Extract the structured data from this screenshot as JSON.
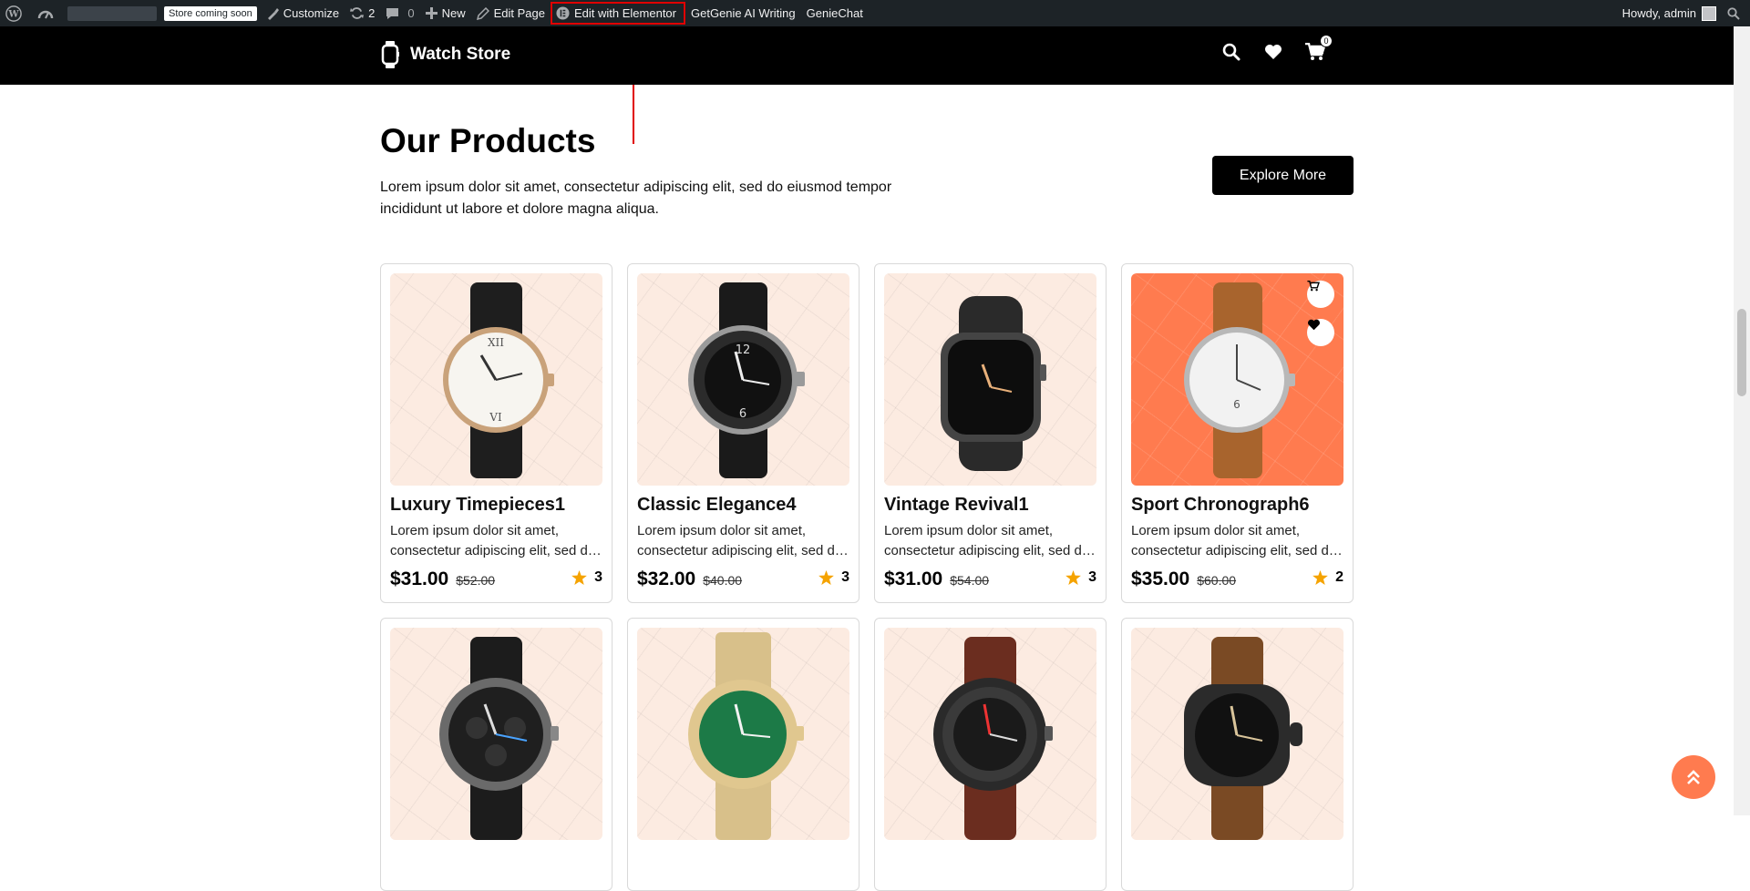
{
  "adminbar": {
    "store_badge": "Store coming soon",
    "customize": "Customize",
    "updates_count": "2",
    "comments_count": "0",
    "new": "New",
    "edit_page": "Edit Page",
    "edit_elementor": "Edit with Elementor",
    "getgenie": "GetGenie AI Writing",
    "geniechat": "GenieChat",
    "howdy": "Howdy, admin"
  },
  "header": {
    "logo_text": "Watch Store",
    "cart_count": "0"
  },
  "section": {
    "title": "Our Products",
    "description": "Lorem ipsum dolor sit amet, consectetur adipiscing elit, sed do eiusmod tempor incididunt ut labore et dolore magna aliqua.",
    "explore_label": "Explore More"
  },
  "products": [
    {
      "title": "Luxury Timepieces1",
      "desc": "Lorem ipsum dolor sit amet, consectetur adipiscing elit, sed do eiusmod",
      "price": "$31.00",
      "old_price": "$52.00",
      "rating": "3"
    },
    {
      "title": "Classic Elegance4",
      "desc": "Lorem ipsum dolor sit amet, consectetur adipiscing elit, sed do eiusmod",
      "price": "$32.00",
      "old_price": "$40.00",
      "rating": "3"
    },
    {
      "title": "Vintage Revival1",
      "desc": "Lorem ipsum dolor sit amet, consectetur adipiscing elit, sed do eiusmod",
      "price": "$31.00",
      "old_price": "$54.00",
      "rating": "3"
    },
    {
      "title": "Sport Chronograph6",
      "desc": "Lorem ipsum dolor sit amet, consectetur adipiscing elit, sed do eiusmod",
      "price": "$35.00",
      "old_price": "$60.00",
      "rating": "2"
    }
  ],
  "colors": {
    "adminbar": "#1d2327",
    "accent": "#ff7b4f",
    "card_bg": "#fcebe1",
    "star": "#f5a300",
    "annotation": "#e00000"
  }
}
